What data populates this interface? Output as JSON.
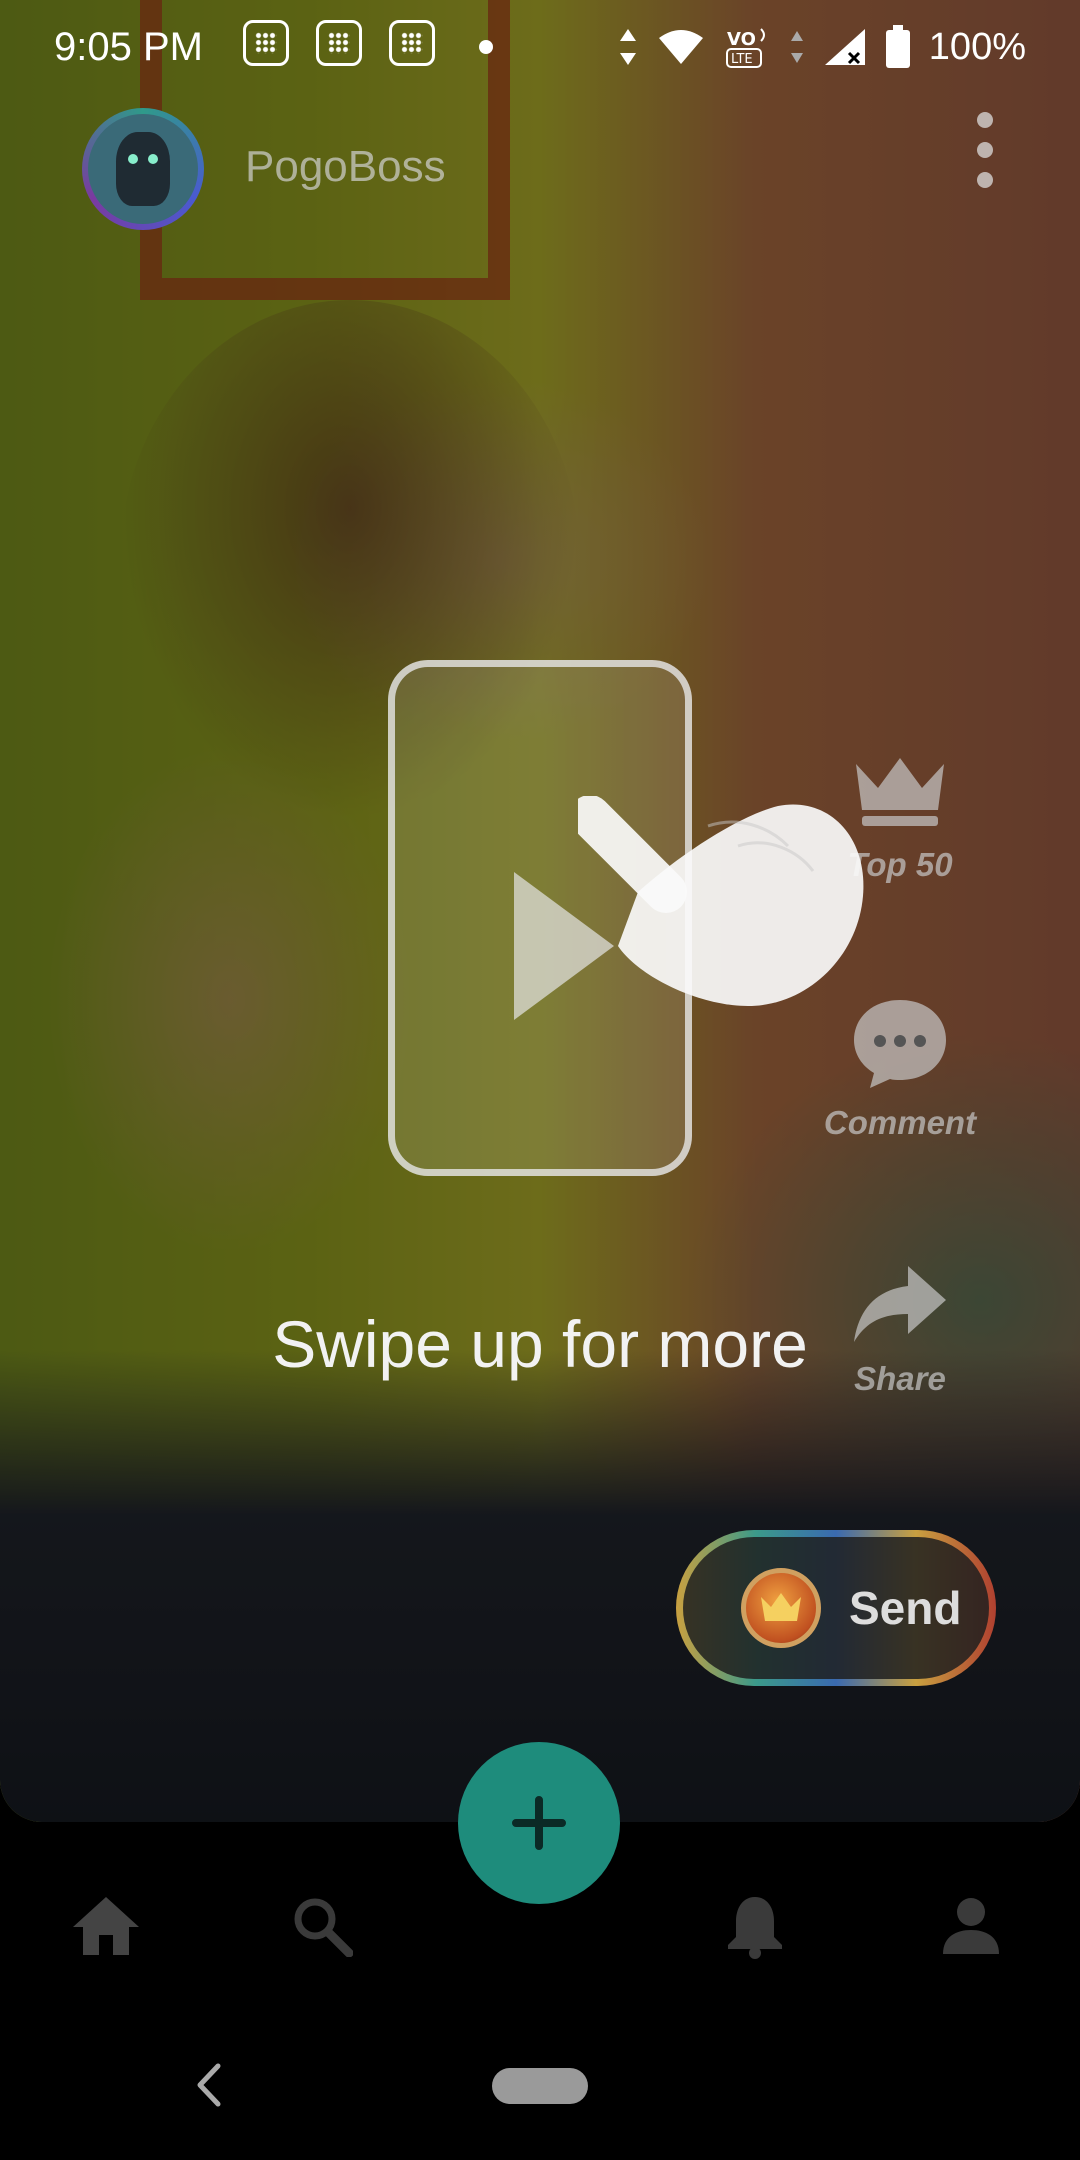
{
  "status_bar": {
    "time": "9:05 PM",
    "battery_text": "100%",
    "icons": [
      "notification-icon",
      "notification-icon",
      "notification-icon",
      "dot-icon",
      "data-arrows-icon",
      "wifi-icon",
      "volte-icon",
      "signal-icon",
      "battery-icon"
    ]
  },
  "header": {
    "username": "PogoBoss",
    "avatar_icon": "avatar",
    "menu_icon": "more-vert-icon"
  },
  "actions": {
    "top50_label": "Top 50",
    "comment_label": "Comment",
    "share_label": "Share"
  },
  "tutorial": {
    "text": "Swipe up for more",
    "icons": [
      "phone-frame-icon",
      "play-icon",
      "swipe-hand-icon"
    ]
  },
  "send_button": {
    "label": "Send",
    "icon": "crown-coin-icon"
  },
  "fab": {
    "icon": "plus-icon"
  },
  "bottom_nav": {
    "items": [
      {
        "name": "home",
        "icon": "home-icon",
        "active": true
      },
      {
        "name": "search",
        "icon": "search-icon",
        "active": false
      },
      {
        "name": "notifications",
        "icon": "bell-icon",
        "active": false
      },
      {
        "name": "profile",
        "icon": "person-icon",
        "active": false
      }
    ]
  },
  "colors": {
    "accent": "#1e8c7c",
    "nav_background": "#000000",
    "inactive_icon": "#3a3a3a"
  }
}
